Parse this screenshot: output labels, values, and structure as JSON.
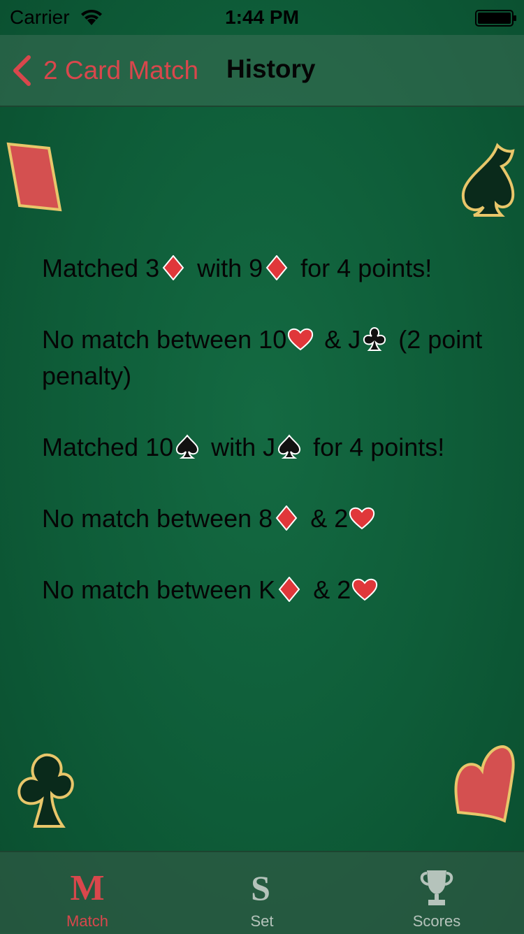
{
  "status_bar": {
    "carrier": "Carrier",
    "time": "1:44 PM"
  },
  "nav": {
    "back_label": "2 Card Match",
    "title": "History"
  },
  "history": [
    {
      "parts": [
        "Matched 3",
        "diamond",
        " with 9",
        "diamond",
        " for 4 points!"
      ]
    },
    {
      "parts": [
        "No match between 10",
        "heart",
        " & J",
        "club",
        " (2 point penalty)"
      ]
    },
    {
      "parts": [
        "Matched 10",
        "spade",
        " with J",
        "spade",
        " for 4 points!"
      ]
    },
    {
      "parts": [
        "No match between 8",
        "diamond",
        " & 2",
        "heart"
      ]
    },
    {
      "parts": [
        "No match between K",
        "diamond",
        " & 2",
        "heart"
      ]
    }
  ],
  "tabs": [
    {
      "label": "Match",
      "icon": "match-m-icon",
      "active": true
    },
    {
      "label": "Set",
      "icon": "set-s-icon",
      "active": false
    },
    {
      "label": "Scores",
      "icon": "trophy-icon",
      "active": false
    }
  ],
  "colors": {
    "accent": "#d9474c",
    "felt": "#0e5c38",
    "inactive_tab": "#b5c3bb"
  }
}
